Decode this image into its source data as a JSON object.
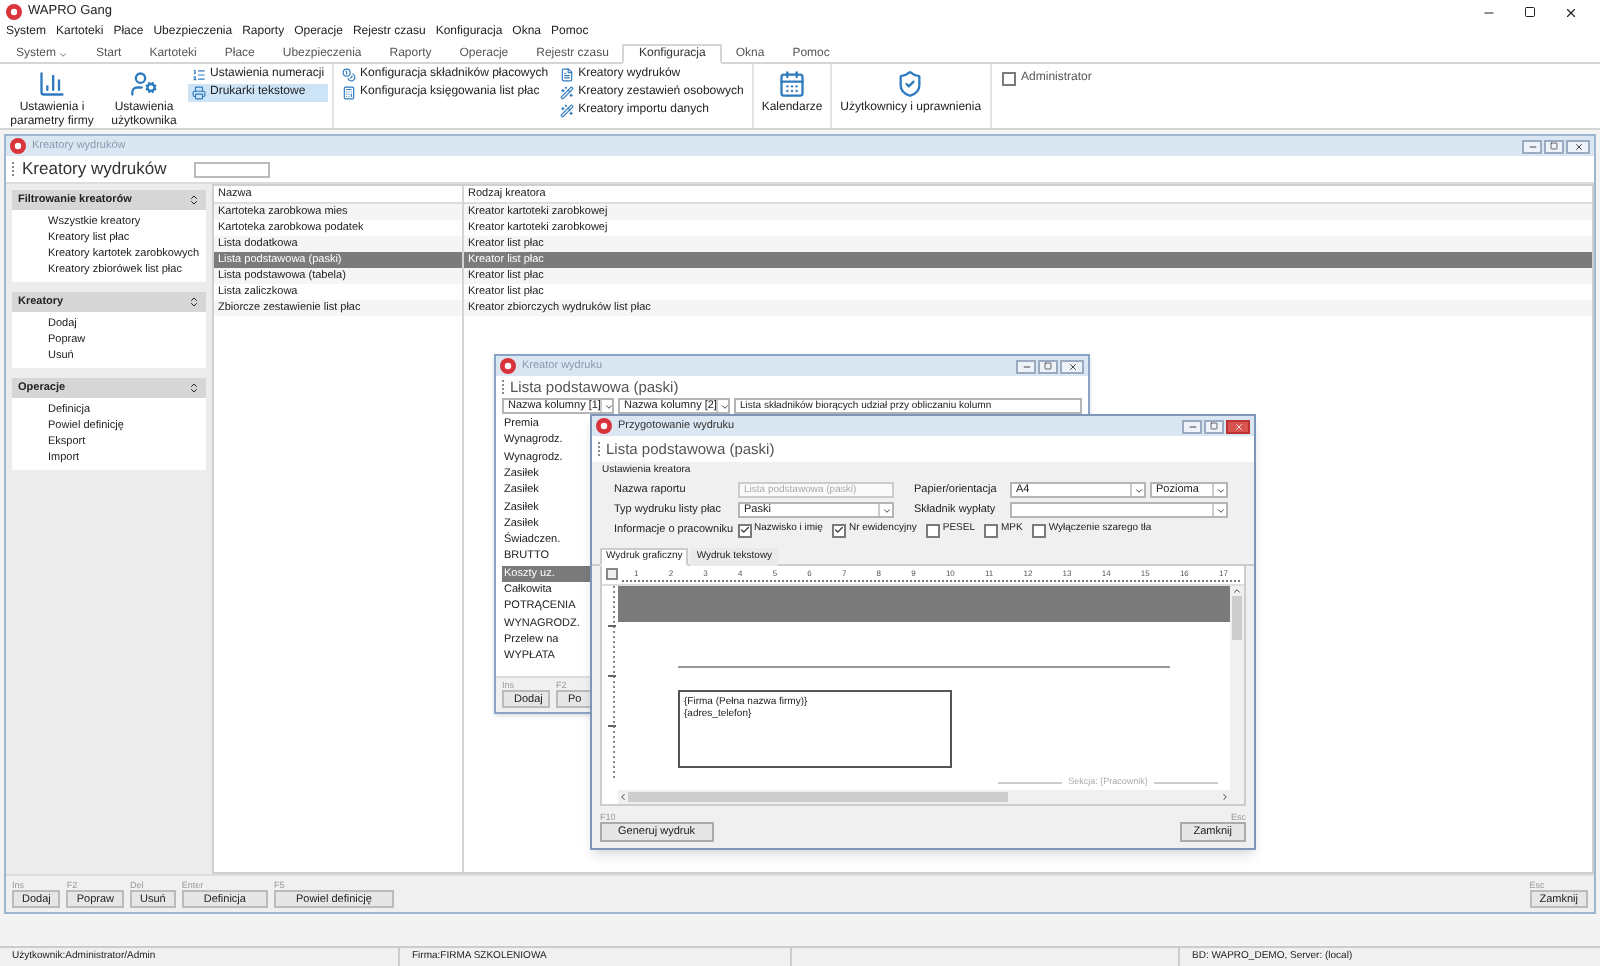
{
  "app": {
    "title": "WAPRO Gang"
  },
  "menu": [
    "System",
    "Kartoteki",
    "Płace",
    "Ubezpieczenia",
    "Raporty",
    "Operacje",
    "Rejestr czasu",
    "Konfiguracja",
    "Okna",
    "Pomoc"
  ],
  "ribbon_tabs": [
    {
      "label": "System",
      "dropdown": true,
      "selected": false
    },
    {
      "label": "Start",
      "dropdown": false,
      "selected": false
    },
    {
      "label": "Kartoteki",
      "dropdown": false,
      "selected": false
    },
    {
      "label": "Płace",
      "dropdown": false,
      "selected": false
    },
    {
      "label": "Ubezpieczenia",
      "dropdown": false,
      "selected": false
    },
    {
      "label": "Raporty",
      "dropdown": false,
      "selected": false
    },
    {
      "label": "Operacje",
      "dropdown": false,
      "selected": false
    },
    {
      "label": "Rejestr czasu",
      "dropdown": false,
      "selected": false
    },
    {
      "label": "Konfiguracja",
      "dropdown": false,
      "selected": true
    },
    {
      "label": "Okna",
      "dropdown": false,
      "selected": false
    },
    {
      "label": "Pomoc",
      "dropdown": false,
      "selected": false
    }
  ],
  "ribbon_groups": [
    {
      "columns": [
        [
          {
            "kind": "large",
            "label": "Ustawienia i parametry firmy",
            "selected": false
          }
        ],
        [
          {
            "kind": "large",
            "label": "Ustawienia użytkownika",
            "selected": false
          }
        ],
        [
          {
            "kind": "small",
            "label": "Ustawienia numeracji",
            "selected": false
          },
          {
            "kind": "small",
            "label": "Drukarki tekstowe",
            "selected": true
          }
        ]
      ]
    },
    {
      "columns": [
        [
          {
            "kind": "small",
            "label": "Konfiguracja składników płacowych",
            "selected": false
          },
          {
            "kind": "small",
            "label": "Konfiguracja księgowania list płac",
            "selected": false
          }
        ],
        [
          {
            "kind": "small",
            "label": "Kreatory wydruków",
            "selected": false
          },
          {
            "kind": "small",
            "label": "Kreatory zestawień osobowych",
            "selected": false
          },
          {
            "kind": "small",
            "label": "Kreatory importu danych",
            "selected": false
          }
        ]
      ]
    },
    {
      "columns": [
        [
          {
            "kind": "large",
            "label": "Kalendarze",
            "selected": false
          }
        ]
      ]
    },
    {
      "columns": [
        [
          {
            "kind": "large",
            "label": "Użytkownicy i uprawnienia",
            "selected": false
          }
        ]
      ]
    },
    {
      "columns": [
        [
          {
            "kind": "checkbox",
            "label": "Administrator",
            "checked": false
          }
        ]
      ]
    }
  ],
  "window": {
    "title": "Kreatory wydruków",
    "header": "Kreatory wydruków"
  },
  "filter_sections": [
    {
      "title": "Filtrowanie kreatorów",
      "items": [
        "Wszystkie kreatory",
        "Kreatory list płac",
        "Kreatory kartotek zarobkowych",
        "Kreatory zbiorówek list płac"
      ]
    },
    {
      "title": "Kreatory",
      "items": [
        "Dodaj",
        "Popraw",
        "Usuń"
      ]
    },
    {
      "title": "Operacje",
      "items": [
        "Definicja",
        "Powiel definicję",
        "Eksport",
        "Import"
      ]
    }
  ],
  "table": {
    "columns": [
      "Nazwa",
      "Rodzaj kreatora"
    ],
    "rows": [
      {
        "cells": [
          "Kartoteka zarobkowa mies",
          "Kreator kartoteki zarobkowej"
        ],
        "selected": false
      },
      {
        "cells": [
          "Kartoteka zarobkowa podatek",
          "Kreator kartoteki zarobkowej"
        ],
        "selected": false
      },
      {
        "cells": [
          "Lista dodatkowa",
          "Kreator list płac"
        ],
        "selected": false
      },
      {
        "cells": [
          "Lista podstawowa (paski)",
          "Kreator list płac"
        ],
        "selected": true
      },
      {
        "cells": [
          "Lista podstawowa (tabela)",
          "Kreator list płac"
        ],
        "selected": false
      },
      {
        "cells": [
          "Lista zaliczkowa",
          "Kreator list płac"
        ],
        "selected": false
      },
      {
        "cells": [
          "Zbiorcze zestawienie list płac",
          "Kreator zbiorczych wydruków list płac"
        ],
        "selected": false
      }
    ]
  },
  "toolbar": {
    "left": [
      {
        "key": "Ins",
        "label": "Dodaj"
      },
      {
        "key": "F2",
        "label": "Popraw"
      },
      {
        "key": "Del",
        "label": "Usuń"
      },
      {
        "key": "Enter",
        "label": "Definicja"
      },
      {
        "key": "F5",
        "label": "Powiel definicję"
      }
    ],
    "right": [
      {
        "key": "Esc",
        "label": "Zamknij"
      }
    ]
  },
  "status_bar": [
    "Użytkownik:Administrator/Admin",
    "Firma:FIRMA SZKOLENIOWA",
    "BD: WAPRO_DEMO, Server: (local)"
  ],
  "creator_dialog": {
    "title": "Kreator wydruku",
    "header": "Lista podstawowa (paski)",
    "selectors": [
      "Nazwa kolumny [1]",
      "Nazwa kolumny [2]"
    ],
    "description": "Lista składników biorących udział przy obliczaniu kolumn",
    "columns": [
      {
        "label": "Premia",
        "selected": false
      },
      {
        "label": "Wynagrodz.",
        "selected": false
      },
      {
        "label": "Wynagrodz.",
        "selected": false
      },
      {
        "label": "Zasiłek",
        "selected": false
      },
      {
        "label": "Zasiłek",
        "selected": false
      },
      {
        "label": "Zasiłek",
        "selected": false
      },
      {
        "label": "Zasiłek",
        "selected": false
      },
      {
        "label": "Świadczen.",
        "selected": false
      },
      {
        "label": "BRUTTO",
        "selected": false
      },
      {
        "label": "Koszty uz.",
        "selected": true
      },
      {
        "label": "Całkowita",
        "selected": false
      },
      {
        "label": "POTRĄCENIA",
        "selected": false
      },
      {
        "label": "WYNAGRODZ.",
        "selected": false
      },
      {
        "label": "Przelew na",
        "selected": false
      },
      {
        "label": "WYPŁATA",
        "selected": false
      }
    ],
    "buttons": [
      {
        "key": "Ins",
        "label": "Dodaj"
      },
      {
        "key": "F2",
        "label": "Po"
      }
    ]
  },
  "print_dialog": {
    "title": "Przygotowanie wydruku",
    "header": "Lista podstawowa (paski)",
    "group": "Ustawienia kreatora",
    "report_name": {
      "label": "Nazwa raportu",
      "value": "Lista podstawowa (paski)",
      "disabled": true
    },
    "paper": {
      "label": "Papier/orientacja",
      "value": "A4",
      "orientation": "Pozioma"
    },
    "print_type": {
      "label": "Typ wydruku listy płac",
      "value": "Paski"
    },
    "component": {
      "label": "Składnik wypłaty"
    },
    "employee_info": {
      "label": "Informacje o pracowniku",
      "options": [
        {
          "label": "Nazwisko i imię",
          "checked": true
        },
        {
          "label": "Nr ewidencyjny",
          "checked": true
        },
        {
          "label": "PESEL",
          "checked": false
        },
        {
          "label": "MPK",
          "checked": false
        },
        {
          "label": "Wyłączenie szarego tła",
          "checked": false
        }
      ]
    },
    "tabs": [
      {
        "label": "Wydruk graficzny",
        "selected": true
      },
      {
        "label": "Wydruk tekstowy",
        "selected": false
      }
    ],
    "ruler": [
      "1",
      "2",
      "3",
      "4",
      "5",
      "6",
      "7",
      "8",
      "9",
      "10",
      "11",
      "12",
      "13",
      "14",
      "15",
      "16",
      "17"
    ],
    "canvas": {
      "box_lines": [
        "{Firma (Pełna nazwa firmy)}",
        "{adres_telefon}"
      ],
      "section": "Sekcja: {Pracownik}"
    },
    "buttons": [
      {
        "key": "F10",
        "label": "Generuj wydruk"
      },
      {
        "key": "Esc",
        "label": "Zamknij"
      }
    ]
  }
}
